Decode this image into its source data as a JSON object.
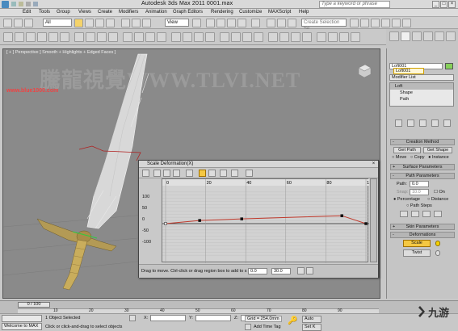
{
  "window": {
    "title": "Autodesk 3ds Max  2011      0001.max",
    "search_placeholder": "Type a keyword or phrase"
  },
  "menu": [
    "Edit",
    "Tools",
    "Group",
    "Views",
    "Create",
    "Modifiers",
    "Animation",
    "Graph Editors",
    "Rendering",
    "Customize",
    "MAXScript",
    "Help"
  ],
  "toolbar": {
    "selection_filter": "All",
    "ref_coord": "View",
    "named_selection_placeholder": "Create Selection Se"
  },
  "viewport": {
    "label": "[ + ] Perspective ] Smooth + Highlights + Edged Faces ]",
    "watermark": "騰龍視覺WWW.TLVI.NET",
    "site_watermark": "www.blue1000.com"
  },
  "command_panel": {
    "object_name": "Loft001",
    "object_name_edit": "Loft001",
    "modifier_list": "Modifier List",
    "stack": [
      "Loft",
      "Shape",
      "Path"
    ],
    "creation_method": {
      "title": "Creation Method",
      "get_path": "Get Path",
      "get_shape": "Get Shape",
      "move": "Move",
      "copy": "Copy",
      "instance": "Instance"
    },
    "surface_parameters": "Surface Parameters",
    "path_parameters": {
      "title": "Path Parameters",
      "path_label": "Path:",
      "path_value": "0.0",
      "snap_label": "Snap:",
      "snap_value": "10.0",
      "on_label": "On",
      "percentage": "Percentage",
      "distance": "Distance",
      "path_steps": "Path Steps"
    },
    "skin_parameters": "Skin Parameters",
    "deformations": {
      "title": "Deformations",
      "scale": "Scale",
      "twist": "Twist"
    }
  },
  "dialog": {
    "title": "Scale Deformation(X)",
    "ruler_ticks": [
      "0",
      "20",
      "40",
      "60",
      "80",
      "100"
    ],
    "y_labels": [
      "100",
      "50",
      "0",
      "-50",
      "-100"
    ],
    "status_text": "Drag to move. Ctrl-click or drag region box to add to s",
    "field1": "0.0",
    "field2": "30.0"
  },
  "chart_data": {
    "type": "line",
    "x": [
      0,
      17,
      38,
      88,
      100
    ],
    "y": [
      0,
      10,
      15,
      25,
      0
    ],
    "xlim": [
      0,
      100
    ],
    "ylim": [
      -120,
      120
    ]
  },
  "timeline": {
    "frame": "0 / 100",
    "ticks": [
      "10",
      "20",
      "30",
      "40",
      "50",
      "60",
      "70",
      "80",
      "90"
    ]
  },
  "status": {
    "selected": "1 Object Selected",
    "prompt": "Click or click-and-drag to select objects",
    "welcome": "Welcome to MAX",
    "x_label": "X:",
    "y_label": "Y:",
    "z_label": "Z:",
    "grid": "Grid = 254.0mm",
    "add_time_tag": "Add Time Tag",
    "auto_key": "Auto",
    "set_key": "Set K"
  },
  "logo_text": "九游"
}
